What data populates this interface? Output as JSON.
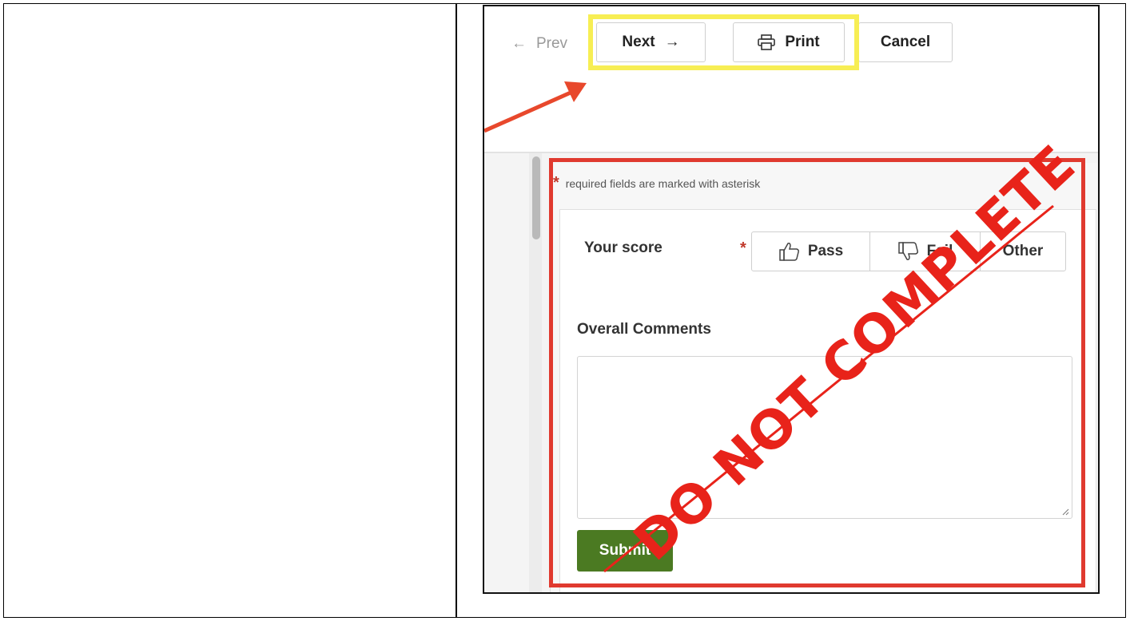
{
  "toolbar": {
    "prev_label": "Prev",
    "next_label": "Next",
    "print_label": "Print",
    "cancel_label": "Cancel"
  },
  "form": {
    "required_note": "required fields are marked with asterisk",
    "required_marker": "*",
    "score_label": "Your score",
    "score_options": [
      "Pass",
      "Fail",
      "Other"
    ],
    "comments_label": "Overall Comments",
    "comments_value": "",
    "submit_label": "Submit"
  },
  "annotation": {
    "stamp_text": "DO NOT COMPLETE",
    "highlight_color": "#f7ee54",
    "stamp_color": "#e8231a",
    "arrow_color": "#e8482c"
  },
  "colors": {
    "submit_bg": "#4b7a22",
    "required_red": "#c0392b"
  }
}
